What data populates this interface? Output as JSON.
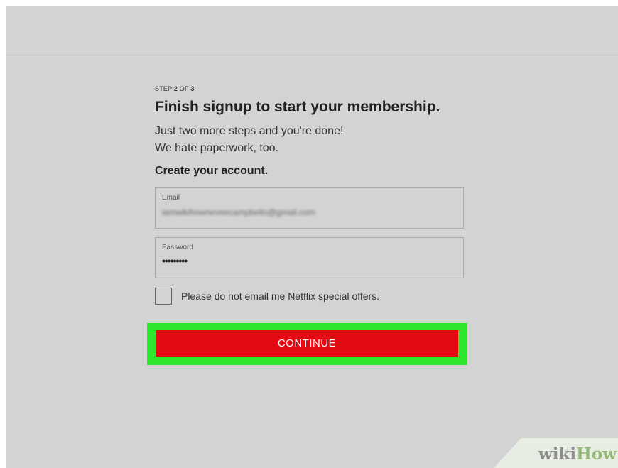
{
  "header": {},
  "signup": {
    "step_prefix": "STEP ",
    "step_current": "2",
    "step_mid": " OF ",
    "step_total": "3",
    "title": "Finish signup to start your membership.",
    "desc_line1": "Just two more steps and you're done!",
    "desc_line2": "We hate paperwork, too.",
    "section_heading": "Create your account."
  },
  "form": {
    "email_label": "Email",
    "email_value": "iamwikihowneveecampbello@gmail.com",
    "password_label": "Password",
    "password_value": "•••••••••",
    "checkbox_label": "Please do not email me Netflix special offers.",
    "checkbox_checked": false,
    "continue_label": "CONTINUE"
  },
  "watermark": {
    "wiki": "wiki",
    "how": "How"
  },
  "colors": {
    "background": "#d3d3d3",
    "button": "#e50914",
    "highlight": "#2ee52e"
  }
}
